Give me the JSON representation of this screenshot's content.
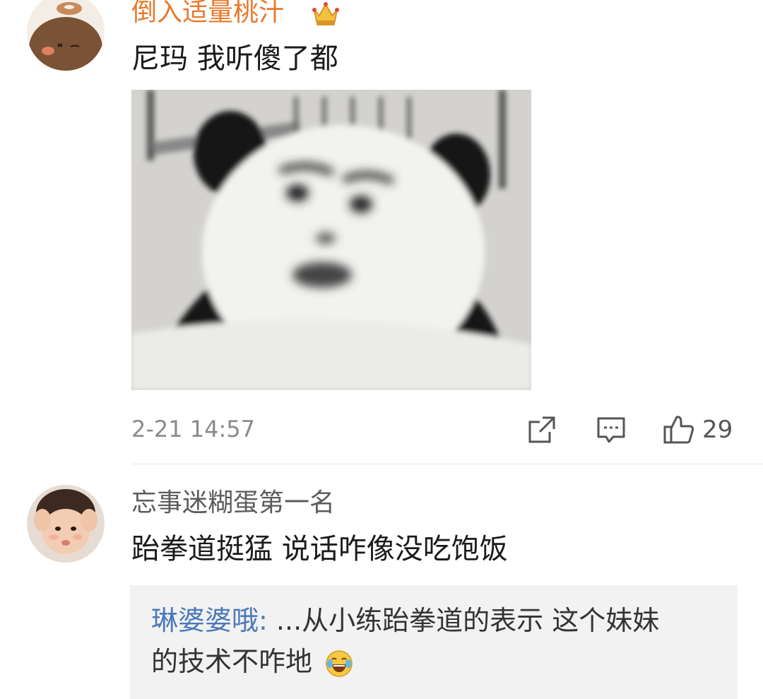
{
  "comments": [
    {
      "author": "倒入适量桃汁",
      "text": "尼玛 我听傻了都",
      "time": "2-21 14:57",
      "like_count": "29",
      "avatar_icon": "donut-avatar",
      "badge_icon": "vip-crown-icon"
    },
    {
      "author": "忘事迷糊蛋第一名",
      "text": "跆拳道挺猛 说话咋像没吃饱饭",
      "avatar_icon": "baby-avatar",
      "reply": {
        "author": "琳婆婆哦",
        "separator": ":",
        "line1": " ...从小练跆拳道的表示 这个妹妹",
        "line2": "的技术不咋地",
        "emoji_icon": "laughing-crying-emoji"
      }
    }
  ],
  "colors": {
    "vip_name": "#e8792c",
    "reply_author": "#4a79b8",
    "reply_bg": "#f2f2f2"
  }
}
